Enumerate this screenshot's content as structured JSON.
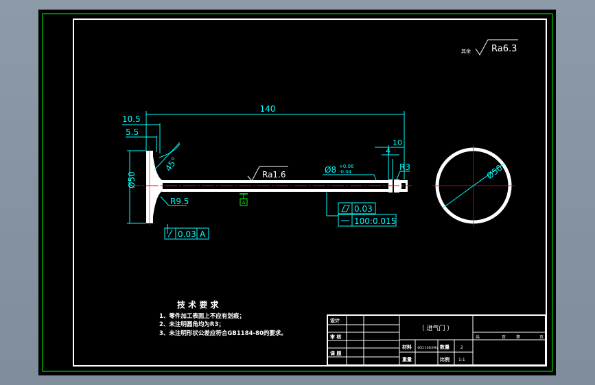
{
  "colors": {
    "background": "#000000",
    "viewport": "#8795a3",
    "outer_frame": "#00ff00",
    "geometry": "#ffffff",
    "dimension": "#00ffff",
    "centerline": "#ff0000",
    "datum": "#00ff00"
  },
  "roughness": {
    "general_prefix": "其余",
    "general_value": "Ra6.3",
    "stem_value": "Ra1.6"
  },
  "dimensions": {
    "total_length": "140",
    "head_dim_1": "10.5",
    "head_dim_2": "5.5",
    "angle": "45°",
    "head_diameter": "Ø50",
    "fillet_radius": "R9.5",
    "end_length": "10",
    "end_small": "4",
    "end_radius": "R3",
    "stem_diameter": "Ø8",
    "stem_tol_upper": "+0.06",
    "stem_tol_lower": "-0.04",
    "circle_diameter": "Ø50"
  },
  "tolerances": {
    "runout_value": "0.03",
    "runout_datum": "A",
    "cylindricity_value": "0.03",
    "straightness_value": "100:0.015",
    "datum_label": "A"
  },
  "notes": {
    "title": "技 术 要 求",
    "items": [
      "1、零件加工表面上不应有划痕；",
      "2、未注明圆角均为R3；",
      "3、未注明形状公差应符合GB1184-80的要求。"
    ]
  },
  "title_block": {
    "designer_label": "设计",
    "checker_label": "审 核",
    "process_label": "课 题",
    "part_name": "（ 进气门 ）",
    "material_label": "材料",
    "material_value": "40Cr10Si2Mo",
    "quantity_label": "数量",
    "quantity_value": "2",
    "weight_label": "重量",
    "scale_label": "比例",
    "scale_value": "1:1",
    "sheet_total_prefix": "共",
    "sheet_total_suffix": "页",
    "sheet_no_prefix": "第",
    "sheet_no_suffix": "页"
  }
}
